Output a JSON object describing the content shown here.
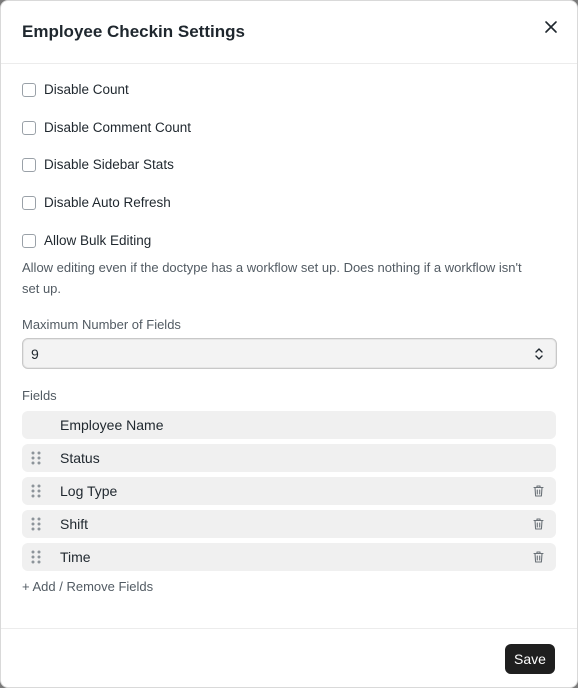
{
  "dialog": {
    "title": "Employee Checkin Settings"
  },
  "options": [
    {
      "label": "Disable Count",
      "checked": false
    },
    {
      "label": "Disable Comment Count",
      "checked": false
    },
    {
      "label": "Disable Sidebar Stats",
      "checked": false
    },
    {
      "label": "Disable Auto Refresh",
      "checked": false
    },
    {
      "label": "Allow Bulk Editing",
      "checked": false
    }
  ],
  "bulk_help": "Allow editing even if the doctype has a workflow set up. Does nothing if a workflow isn't set up.",
  "max_fields": {
    "label": "Maximum Number of Fields",
    "value": "9"
  },
  "fields": {
    "label": "Fields",
    "items": [
      {
        "name": "Employee Name"
      },
      {
        "name": "Status"
      },
      {
        "name": "Log Type"
      },
      {
        "name": "Shift"
      },
      {
        "name": "Time"
      }
    ],
    "add_remove": "+ Add / Remove Fields"
  },
  "footer": {
    "save_label": "Save"
  },
  "icons": {
    "close": "close-icon",
    "drag": "drag-handle-icon",
    "trash": "trash-icon",
    "select_caret": "chevron-up-down-icon"
  }
}
